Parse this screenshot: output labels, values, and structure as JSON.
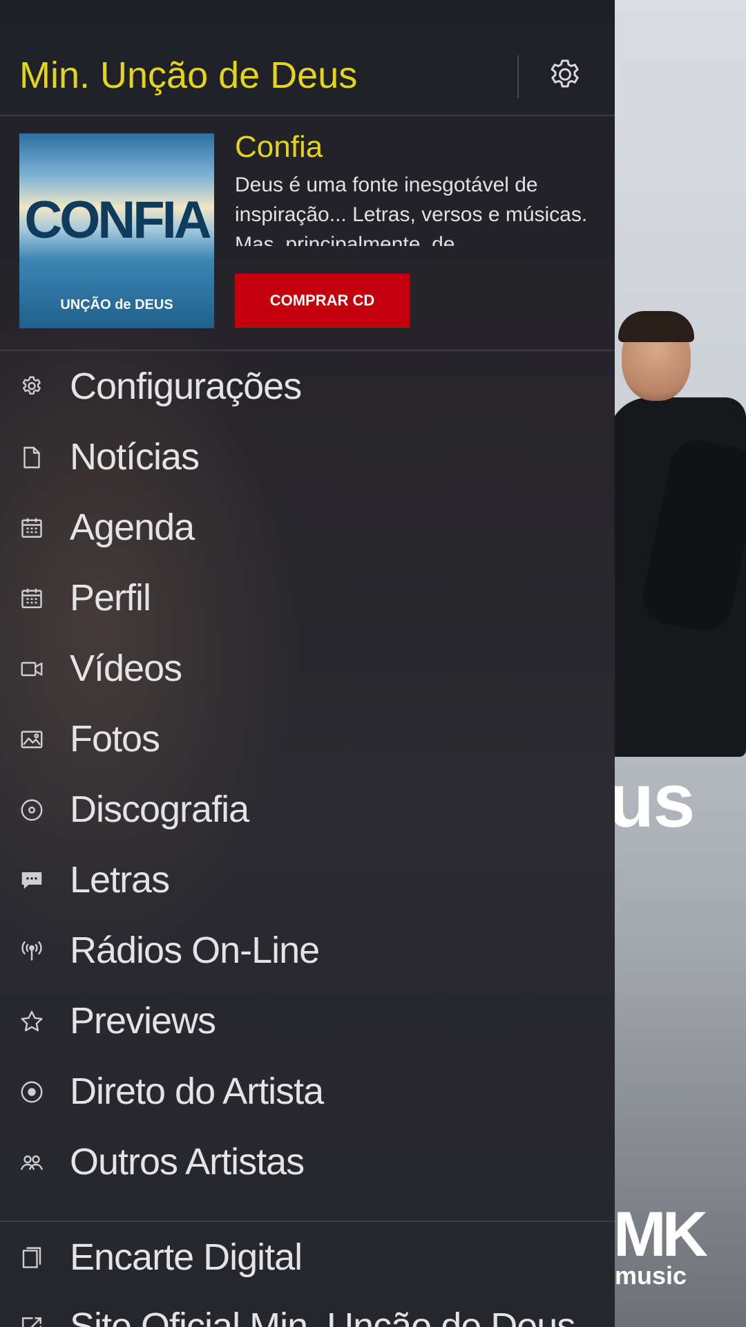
{
  "header": {
    "title": "Min. Unção de Deus",
    "settings_icon": "gear-icon"
  },
  "promo": {
    "album_art_title": "CONFIA",
    "album_art_subtitle": "UNÇÃO de DEUS",
    "title": "Confia",
    "description": "Deus é uma fonte inesgotável de inspiração... Letras, versos e músicas. Mas, principalmente, de",
    "buy_label": "COMPRAR CD"
  },
  "menu": [
    {
      "label": "Configurações",
      "icon": "gear-icon"
    },
    {
      "label": "Notícias",
      "icon": "document-icon"
    },
    {
      "label": "Agenda",
      "icon": "calendar-icon"
    },
    {
      "label": "Perfil",
      "icon": "calendar-icon"
    },
    {
      "label": "Vídeos",
      "icon": "video-camera-icon"
    },
    {
      "label": "Fotos",
      "icon": "image-icon"
    },
    {
      "label": "Discografia",
      "icon": "disc-icon"
    },
    {
      "label": "Letras",
      "icon": "chat-bubble-icon"
    },
    {
      "label": "Rádios On-Line",
      "icon": "radio-antenna-icon"
    },
    {
      "label": "Previews",
      "icon": "star-icon"
    },
    {
      "label": "Direto do Artista",
      "icon": "target-icon"
    },
    {
      "label": "Outros Artistas",
      "icon": "people-icon"
    }
  ],
  "bottom_menu": [
    {
      "label": "Encarte Digital",
      "icon": "booklet-icon"
    },
    {
      "label": "Site Oficial Min. Unção de Deus",
      "icon": "external-link-icon"
    }
  ],
  "background": {
    "word_fragment": "us",
    "logo_top": "",
    "logo": "MK",
    "logo_sub": "music"
  }
}
